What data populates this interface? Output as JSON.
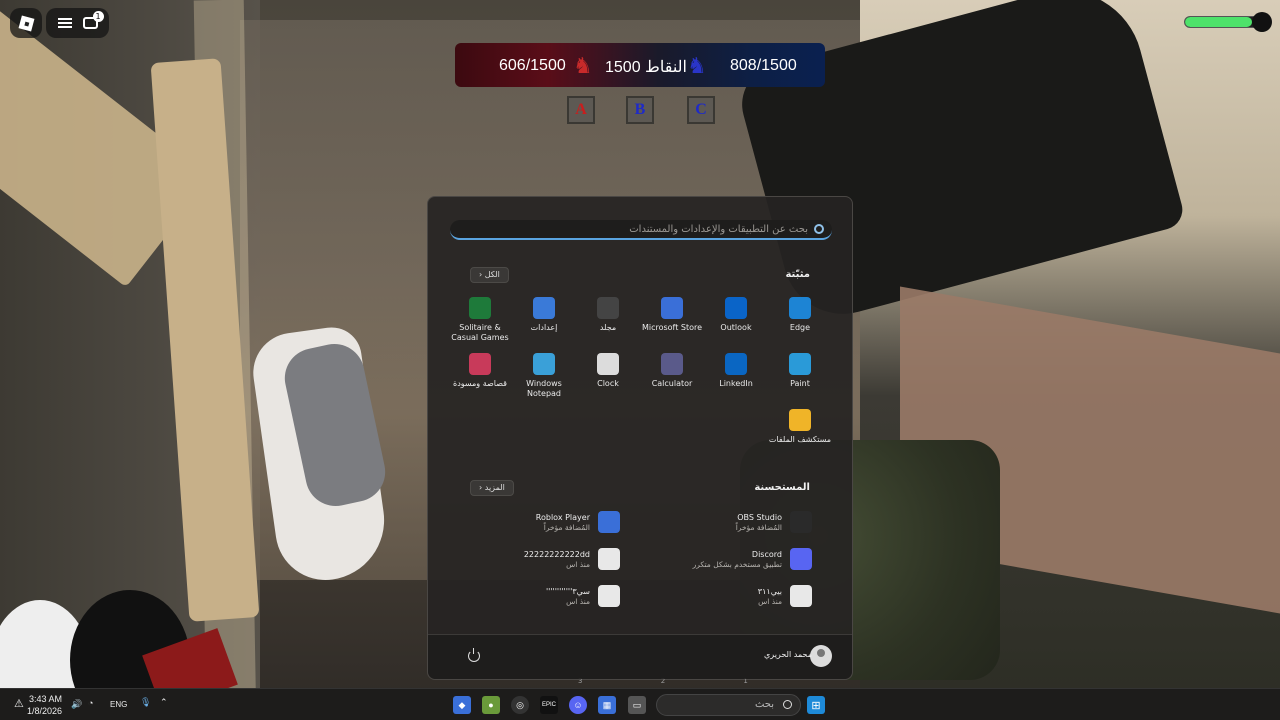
{
  "game": {
    "notifications_count": "1",
    "health_fraction": 0.9,
    "score": {
      "red": "606/1500",
      "points": "1500 النقاط",
      "blue": "808/1500"
    },
    "flags": [
      "A",
      "B",
      "C"
    ],
    "flag_colors": [
      "#c81e1e",
      "#1e2ac8",
      "#1e2ac8"
    ]
  },
  "start_menu": {
    "search_placeholder": "بحث عن التطبيقات والإعدادات والمستندات",
    "pinned_title": "مثبّتة",
    "all_button": "الكل",
    "pinned_apps": [
      {
        "label": "Edge",
        "icon": "edge-icon",
        "color": "#1d84d4"
      },
      {
        "label": "Outlook",
        "icon": "outlook-icon",
        "color": "#0a64c8"
      },
      {
        "label": "Microsoft Store",
        "icon": "store-icon",
        "color": "#3a6fd8"
      },
      {
        "label": "مجلد",
        "icon": "folder-shortcut-icon",
        "color": "#444"
      },
      {
        "label": "إعدادات",
        "icon": "settings-icon",
        "color": "#3a7ad8"
      },
      {
        "label": "Solitaire & Casual Games",
        "icon": "solitaire-icon",
        "color": "#1e7a3a"
      },
      {
        "label": "Paint",
        "icon": "paint-icon",
        "color": "#2a9ad8"
      },
      {
        "label": "LinkedIn",
        "icon": "linkedin-icon",
        "color": "#0a66c2"
      },
      {
        "label": "Calculator",
        "icon": "calculator-icon",
        "color": "#5a5a8a"
      },
      {
        "label": "Clock",
        "icon": "clock-icon",
        "color": "#dcdcdc"
      },
      {
        "label": "Windows Notepad",
        "icon": "notepad-icon",
        "color": "#3aa0d8"
      },
      {
        "label": "قصاصة ومسودة",
        "icon": "snipping-tool-icon",
        "color": "#c83a5a"
      },
      {
        "label": "مستكشف الملفات",
        "icon": "file-explorer-icon",
        "color": "#f0b428"
      }
    ],
    "recommended_title": "المستحسنة",
    "more_button": "المزيد",
    "recommended": [
      {
        "name": "OBS Studio",
        "sub": "المُضافة مؤخراً",
        "icon": "obs-icon",
        "color": "#2a2a2a"
      },
      {
        "name": "Roblox Player",
        "sub": "المُضافة مؤخراً",
        "icon": "roblox-icon",
        "color": "#3a6fd8"
      },
      {
        "name": "Discord",
        "sub": "تطبيق مستخدم بشكل متكرر",
        "icon": "discord-icon",
        "color": "#5865f2"
      },
      {
        "name": "22222222222dd",
        "sub": "منذ اس",
        "icon": "image-file-icon",
        "color": "#e8e8e8"
      },
      {
        "name": "بيي٣١١",
        "sub": "منذ اس",
        "icon": "image-file-icon",
        "color": "#e8e8e8"
      },
      {
        "name": "سي٣''''''''''''",
        "sub": "منذ اس",
        "icon": "image-file-icon",
        "color": "#e8e8e8"
      }
    ],
    "user_name": "محمد الحريري",
    "page_dots": [
      "1",
      "2",
      "3"
    ]
  },
  "taskbar": {
    "search_label": "بحث",
    "time": "3:43 AM",
    "date": "1/8/2026",
    "language": "ENG"
  }
}
